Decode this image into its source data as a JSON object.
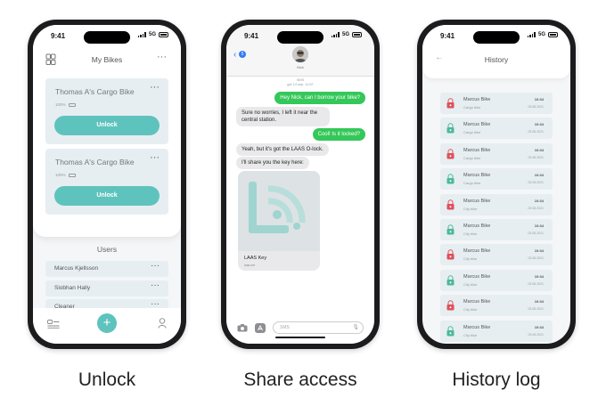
{
  "status_bar": {
    "time": "9:41",
    "network": "5G"
  },
  "unlock_screen": {
    "title": "My Bikes",
    "menu_dots": "···",
    "bikes": [
      {
        "name": "Thomas A's Cargo Bike",
        "battery": "100%",
        "button": "Unlock"
      },
      {
        "name": "Thomas A's Cargo Bike",
        "battery": "100%",
        "button": "Unlock"
      }
    ],
    "users_title": "Users",
    "users": [
      "Marcus Kjellsson",
      "Siobhan Hally",
      "Cleaner"
    ],
    "add_label": "+"
  },
  "share_screen": {
    "back_count": "5",
    "contact_name": "Nick",
    "meta_line1": "SMS",
    "meta_line2": "gör 14 sep, 12:57",
    "messages": [
      {
        "dir": "out",
        "text": "Hey Nick, can I borrow your bike?"
      },
      {
        "dir": "in",
        "text": "Sure no worries, I left it near the central station."
      },
      {
        "dir": "out",
        "text": "Cool! Is it locked?"
      },
      {
        "dir": "in",
        "text": "Yeah, but it's got the LAAS O-lock."
      },
      {
        "dir": "in",
        "text": "I'll share you the key here:"
      }
    ],
    "key_card": {
      "title": "LAAS Key",
      "subtitle": "laas.me"
    },
    "input_placeholder": "SMS"
  },
  "history_screen": {
    "title": "History",
    "rows": [
      {
        "bike": "Marcus Bike",
        "type": "Cargo bike",
        "time": "10:34",
        "date": "03.05.2021",
        "state": "locked"
      },
      {
        "bike": "Marcus Bike",
        "type": "Cargo bike",
        "time": "10:34",
        "date": "03.05.2021",
        "state": "unlocked"
      },
      {
        "bike": "Marcus Bike",
        "type": "Cargo bike",
        "time": "10:34",
        "date": "03.05.2021",
        "state": "locked"
      },
      {
        "bike": "Marcus Bike",
        "type": "Cargo bike",
        "time": "10:34",
        "date": "03.05.2021",
        "state": "unlocked"
      },
      {
        "bike": "Marcus Bike",
        "type": "City bike",
        "time": "10:34",
        "date": "03.05.2021",
        "state": "locked"
      },
      {
        "bike": "Marcus Bike",
        "type": "City bike",
        "time": "10:34",
        "date": "03.05.2021",
        "state": "unlocked"
      },
      {
        "bike": "Marcus Bike",
        "type": "City bike",
        "time": "10:34",
        "date": "03.05.2021",
        "state": "locked"
      },
      {
        "bike": "Marcus Bike",
        "type": "City bike",
        "time": "10:34",
        "date": "03.05.2021",
        "state": "unlocked"
      },
      {
        "bike": "Marcus Bike",
        "type": "City bike",
        "time": "10:34",
        "date": "03.05.2021",
        "state": "locked"
      },
      {
        "bike": "Marcus Bike",
        "type": "City bike",
        "time": "10:34",
        "date": "03.05.2021",
        "state": "unlocked"
      }
    ]
  },
  "captions": {
    "unlock": "Unlock",
    "share": "Share access",
    "history": "History log"
  },
  "colors": {
    "accent": "#5fc3bd",
    "imessage_green": "#34c759",
    "locked_red": "#e0505a",
    "unlocked_green": "#4cb89a"
  },
  "icons": [
    "bike-logo-icon",
    "list-icon",
    "plus-icon",
    "person-icon",
    "back-chevron-icon",
    "camera-icon",
    "app-store-icon",
    "mic-icon",
    "lock-icon"
  ]
}
